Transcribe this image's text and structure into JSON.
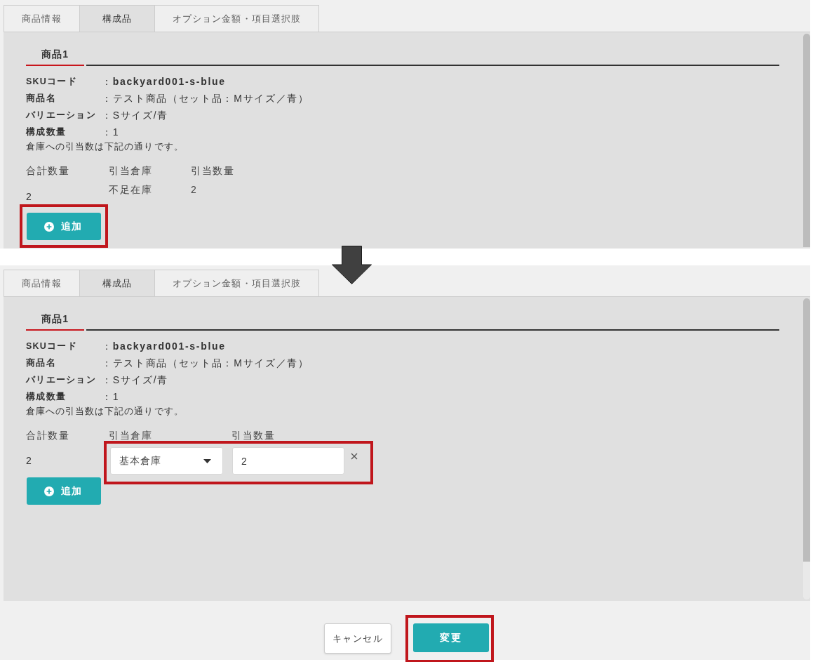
{
  "screens": [
    {
      "tabs": [
        {
          "label": "商品情報",
          "selected": false
        },
        {
          "label": "構成品",
          "selected": true
        },
        {
          "label": "オプション金額・項目選択肢",
          "selected": false
        }
      ],
      "item_tab": {
        "label": "商品1",
        "selected": true
      },
      "details": [
        {
          "label": "SKUコード",
          "value": "：**backyard001-s-blue**"
        },
        {
          "label": "商品名",
          "value": "：テスト商品（セット品：Mサイズ／青）"
        },
        {
          "label": "バリエーション",
          "value": "：Sサイズ/青"
        },
        {
          "label": "構成数量",
          "value": "：1"
        }
      ],
      "note": "倉庫への引当数は下記の通りです。",
      "allocation": {
        "columns": [
          "合計数量",
          "引当倉庫",
          "引当数量"
        ],
        "total": "2",
        "rows": [
          {
            "kind": "readonly",
            "warehouse": "不足在庫",
            "quantity": "2",
            "highlighted": false
          }
        ]
      },
      "add_button": {
        "label": "追加",
        "highlighted": true
      }
    },
    {
      "tabs": [
        {
          "label": "商品情報",
          "selected": false
        },
        {
          "label": "構成品",
          "selected": true
        },
        {
          "label": "オプション金額・項目選択肢",
          "selected": false
        }
      ],
      "item_tab": {
        "label": "商品1",
        "selected": true
      },
      "details": [
        {
          "label": "SKUコード",
          "value": "：**backyard001-s-blue**"
        },
        {
          "label": "商品名",
          "value": "：テスト商品（セット品：Mサイズ／青）"
        },
        {
          "label": "バリエーション",
          "value": "：Sサイズ/青"
        },
        {
          "label": "構成数量",
          "value": "：1"
        }
      ],
      "note": "倉庫への引当数は下記の通りです。",
      "allocation": {
        "columns": [
          "合計数量",
          "引当倉庫",
          "引当数量"
        ],
        "total": "2",
        "rows": [
          {
            "kind": "editable",
            "warehouse": "基本倉庫",
            "quantity": "2",
            "highlighted": true
          }
        ]
      },
      "add_button": {
        "label": "追加",
        "highlighted": false
      },
      "footer": [
        {
          "label": "キャンセル",
          "kind": "secondary",
          "highlighted": false
        },
        {
          "label": "変更",
          "kind": "primary",
          "highlighted": true
        }
      ]
    }
  ]
}
